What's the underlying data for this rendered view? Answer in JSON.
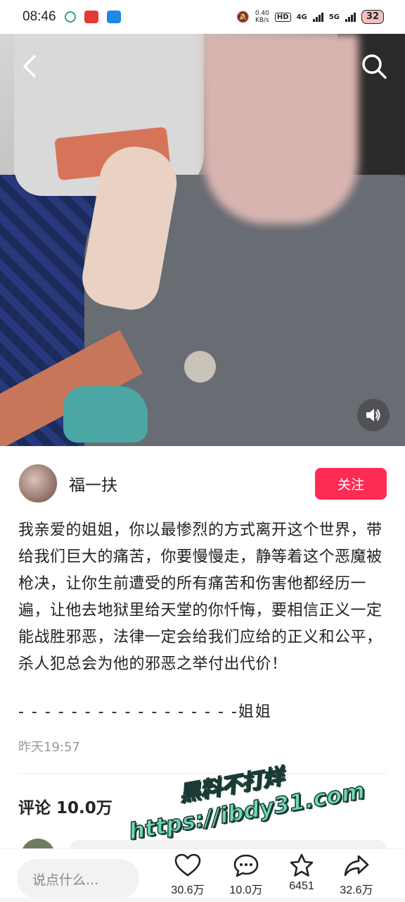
{
  "status_bar": {
    "time": "08:46",
    "net_speed_value": "0.40",
    "net_speed_unit": "KB/s",
    "hd_label": "HD",
    "network_4g": "4G",
    "network_5g": "5G",
    "battery": "32"
  },
  "author": {
    "name": "福一扶",
    "follow_label": "关注"
  },
  "post": {
    "text": "我亲爱的姐姐，你以最惨烈的方式离开这个世界，带给我们巨大的痛苦，你要慢慢走，静等着这个恶魔被枪决，让你生前遭受的所有痛苦和伤害他都经历一遍，让他去地狱里给天堂的你忏悔，要相信正义一定能战胜邪恶，法律一定会给我们应给的正义和公平，杀人犯总会为他的邪恶之举付出代价！",
    "signature": "- - - - - - - - - - - - - - - - -姐姐",
    "time": "昨天19:57"
  },
  "comments": {
    "title": "评论 10.0万"
  },
  "watermark": {
    "line1": "黑料不打烊",
    "line2": "https://ibdy31.com"
  },
  "bottom_bar": {
    "input_placeholder": "说点什么...",
    "likes": "30.6万",
    "comments": "10.0万",
    "favorites": "6451",
    "shares": "32.6万"
  },
  "colors": {
    "follow_button": "#fe2c55",
    "watermark_fill": "#6fd9b6"
  },
  "icons": [
    "back-arrow-icon",
    "search-icon",
    "sound-icon",
    "heart-icon",
    "comment-bubble-icon",
    "star-icon",
    "share-icon"
  ]
}
